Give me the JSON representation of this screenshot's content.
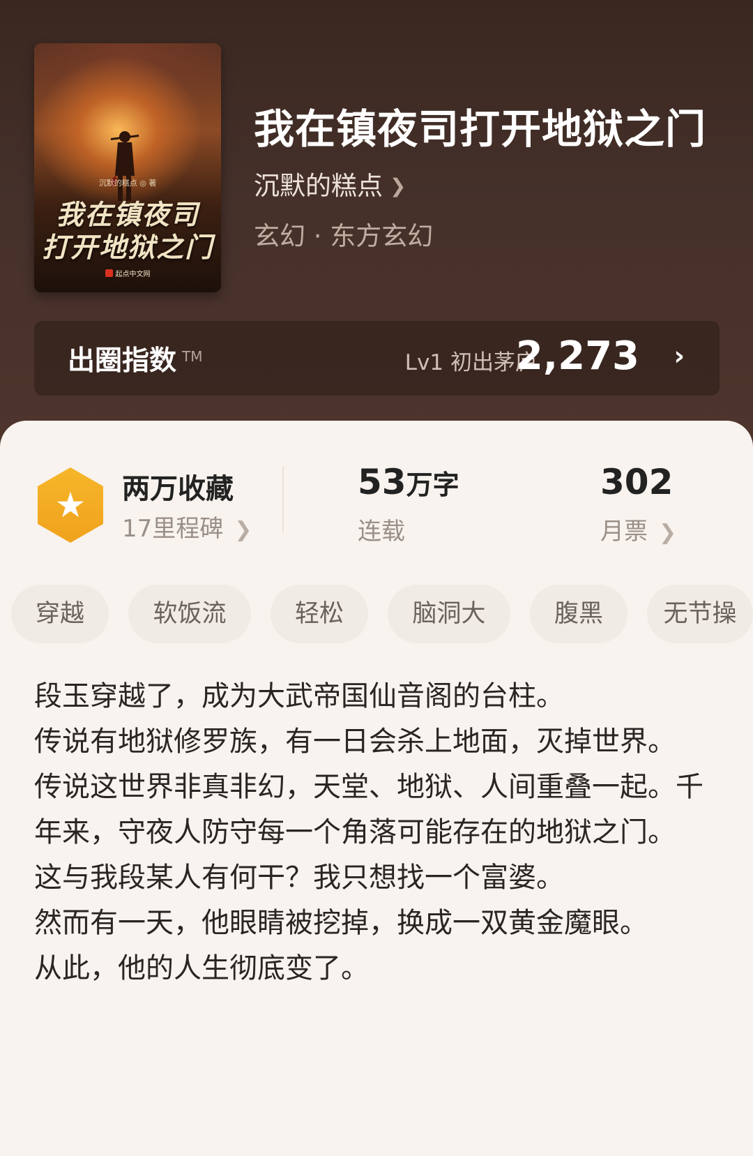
{
  "book": {
    "title": "我在镇夜司打开地狱之门",
    "author": "沉默的糕点",
    "genre": "玄幻 · 东方玄幻",
    "cover": {
      "title_line1": "我在镇夜司",
      "title_line2": "打开地狱之门",
      "author_line": "沉默的糕点 ◎ 著",
      "publisher": "起点中文网"
    }
  },
  "influence": {
    "label": "出圈指数",
    "tm": "TM",
    "level": "Lv1 初出茅庐",
    "score": "2,273"
  },
  "stats": {
    "collection_title": "两万收藏",
    "collection_sub": "17里程碑",
    "words_num": "53",
    "words_unit": "万字",
    "status": "连载",
    "votes": "302",
    "votes_label": "月票"
  },
  "tags": [
    "穿越",
    "软饭流",
    "轻松",
    "脑洞大",
    "腹黑",
    "无节操"
  ],
  "synopsis": [
    "段玉穿越了，成为大武帝国仙音阁的台柱。",
    "传说有地狱修罗族，有一日会杀上地面，灭掉世界。",
    "传说这世界非真非幻，天堂、地狱、人间重叠一起。千年来，守夜人防守每一个角落可能存在的地狱之门。",
    "这与我段某人有何干？我只想找一个富婆。",
    "然而有一天，他眼睛被挖掉，换成一双黄金魔眼。",
    "从此，他的人生彻底变了。"
  ],
  "icons": {
    "milestone": "star-hexagon-icon",
    "chevron": "chevron-right-icon"
  },
  "colors": {
    "header_bg": "#45302a",
    "badge": "#f2a91f",
    "panel_bg": "#f8f3ee"
  }
}
